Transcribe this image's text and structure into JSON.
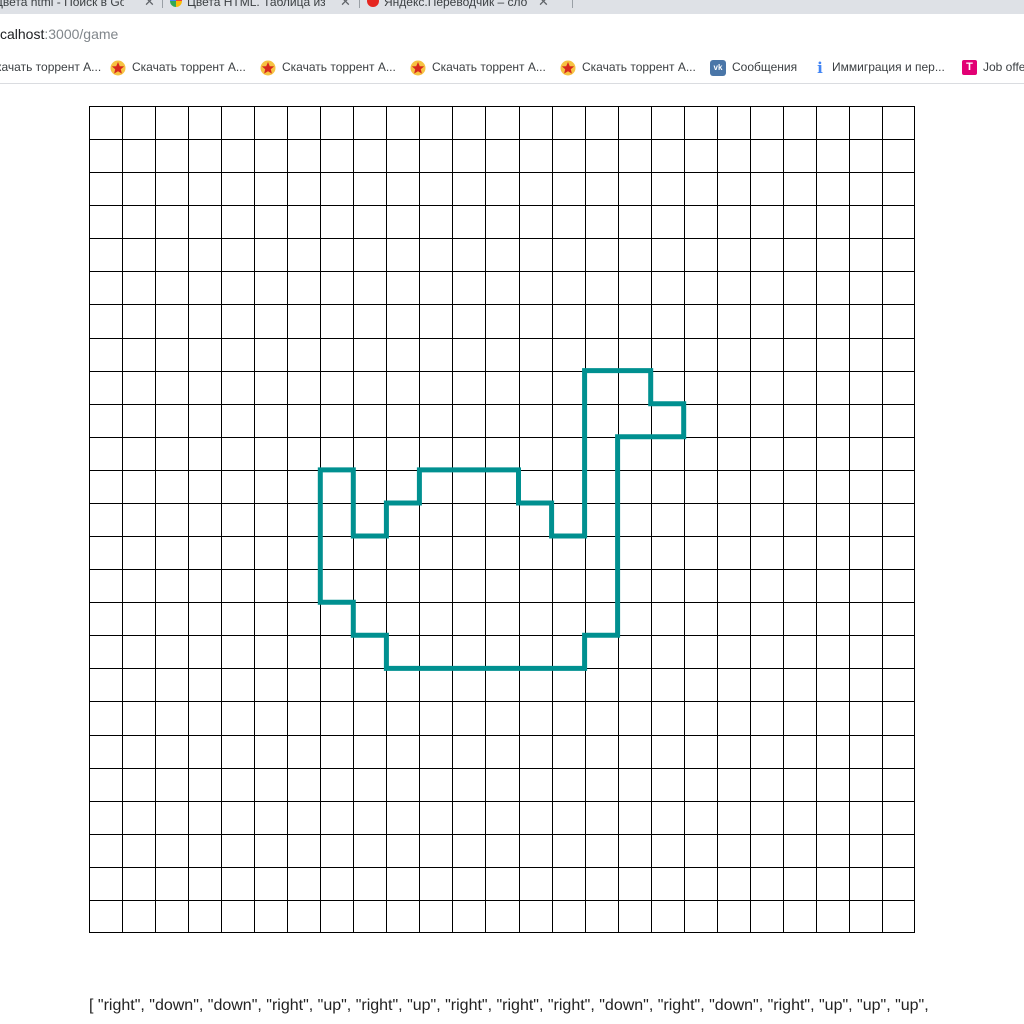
{
  "browser": {
    "tabs": [
      {
        "title": "Цвета html - Поиск в Goog"
      },
      {
        "title": "Цвета HTML. Таблица из"
      },
      {
        "title": "Яндекс.Переводчик – сло"
      }
    ],
    "url": {
      "host": "calhost",
      "path": ":3000/game"
    },
    "bookmarks": [
      {
        "label": "качать торрент А...",
        "icon": "star-icon"
      },
      {
        "label": "Скачать торрент А...",
        "icon": "star-icon"
      },
      {
        "label": "Скачать торрент А...",
        "icon": "star-icon"
      },
      {
        "label": "Скачать торрент А...",
        "icon": "star-icon"
      },
      {
        "label": "Скачать торрент А...",
        "icon": "star-icon"
      },
      {
        "label": "Сообщения",
        "icon": "vk-icon"
      },
      {
        "label": "Иммиграция и пер...",
        "icon": "info-icon"
      },
      {
        "label": "Job offe",
        "icon": "t-icon"
      }
    ]
  },
  "game": {
    "grid": {
      "cols": 25,
      "rows": 25
    },
    "path_color": "#009090",
    "path": [
      [
        7,
        11
      ],
      [
        8,
        11
      ],
      [
        8,
        13
      ],
      [
        9,
        13
      ],
      [
        9,
        12
      ],
      [
        10,
        12
      ],
      [
        10,
        11
      ],
      [
        13,
        11
      ],
      [
        13,
        12
      ],
      [
        14,
        12
      ],
      [
        14,
        13
      ],
      [
        15,
        13
      ],
      [
        15,
        8
      ],
      [
        17,
        8
      ],
      [
        17,
        9
      ],
      [
        18,
        9
      ],
      [
        18,
        10
      ],
      [
        16,
        10
      ],
      [
        16,
        16
      ],
      [
        15,
        16
      ],
      [
        15,
        17
      ],
      [
        9,
        17
      ],
      [
        9,
        16
      ],
      [
        8,
        16
      ],
      [
        8,
        15
      ],
      [
        7,
        15
      ],
      [
        7,
        11
      ]
    ],
    "moves_text": "[ \"right\", \"down\", \"down\", \"right\", \"up\", \"right\", \"up\", \"right\", \"right\", \"right\", \"down\", \"right\", \"down\", \"right\", \"up\", \"up\", \"up\","
  }
}
